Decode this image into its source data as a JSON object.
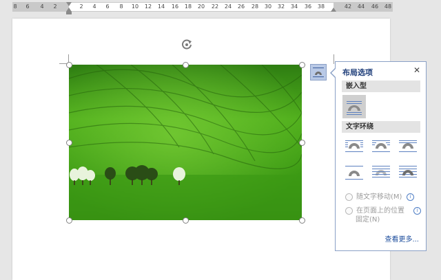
{
  "ruler": {
    "labels": [
      "8",
      "6",
      "4",
      "2",
      "2",
      "4",
      "6",
      "8",
      "10",
      "12",
      "14",
      "16",
      "18",
      "20",
      "22",
      "24",
      "26",
      "28",
      "30",
      "32",
      "34",
      "36",
      "38",
      "42",
      "44",
      "46",
      "48"
    ]
  },
  "image": {
    "description_name": "green-rolling-field-photo"
  },
  "layout_options": {
    "title": "布局选项",
    "close_label": "✕",
    "inline_header": "嵌入型",
    "wrap_header": "文字环绕",
    "radio_move_with_text": "随文字移动(M)",
    "radio_fix_position_line1": "在页面上的位置",
    "radio_fix_position_line2": "固定(N)",
    "see_more": "查看更多..."
  },
  "colors": {
    "accent": "#1f3e7a",
    "link": "#1f4f9e",
    "panel_border": "#8aa0c6",
    "wrap_icon_fill": "#9a9a9a",
    "wrap_icon_lines": "#5b7fbf"
  }
}
